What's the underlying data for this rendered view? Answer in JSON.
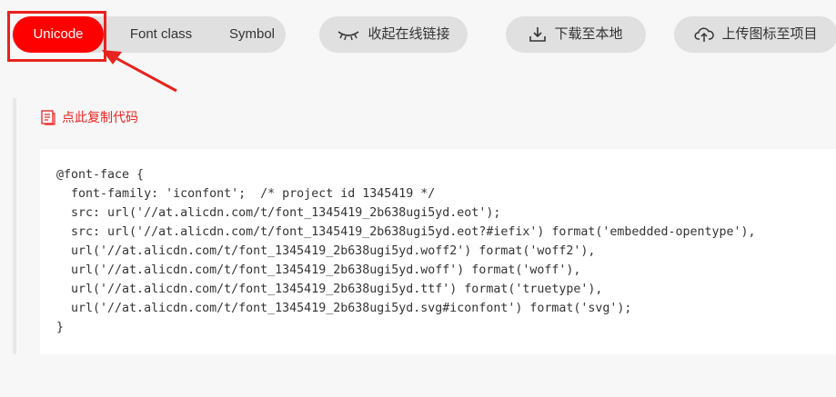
{
  "tabs": [
    {
      "label": "Unicode",
      "active": true
    },
    {
      "label": "Font class",
      "active": false
    },
    {
      "label": "Symbol",
      "active": false
    }
  ],
  "actions": {
    "collapse_label": "收起在线链接",
    "download_label": "下载至本地",
    "upload_label": "上传图标至项目"
  },
  "copy_label": "点此复制代码",
  "code_lines": [
    "@font-face {",
    "  font-family: 'iconfont';  /* project id 1345419 */",
    "  src: url('//at.alicdn.com/t/font_1345419_2b638ugi5yd.eot');",
    "  src: url('//at.alicdn.com/t/font_1345419_2b638ugi5yd.eot?#iefix') format('embedded-opentype'),",
    "  url('//at.alicdn.com/t/font_1345419_2b638ugi5yd.woff2') format('woff2'),",
    "  url('//at.alicdn.com/t/font_1345419_2b638ugi5yd.woff') format('woff'),",
    "  url('//at.alicdn.com/t/font_1345419_2b638ugi5yd.ttf') format('truetype'),",
    "  url('//at.alicdn.com/t/font_1345419_2b638ugi5yd.svg#iconfont') format('svg');",
    "}"
  ],
  "colors": {
    "accent": "#ff0000",
    "annotation": "#e8231d",
    "pill_bg": "#e0e0e0",
    "link": "#ee2323"
  },
  "icons": {
    "collapse": "closed-eye-icon",
    "download": "download-icon",
    "upload": "cloud-upload-icon",
    "copy": "copy-document-icon"
  }
}
